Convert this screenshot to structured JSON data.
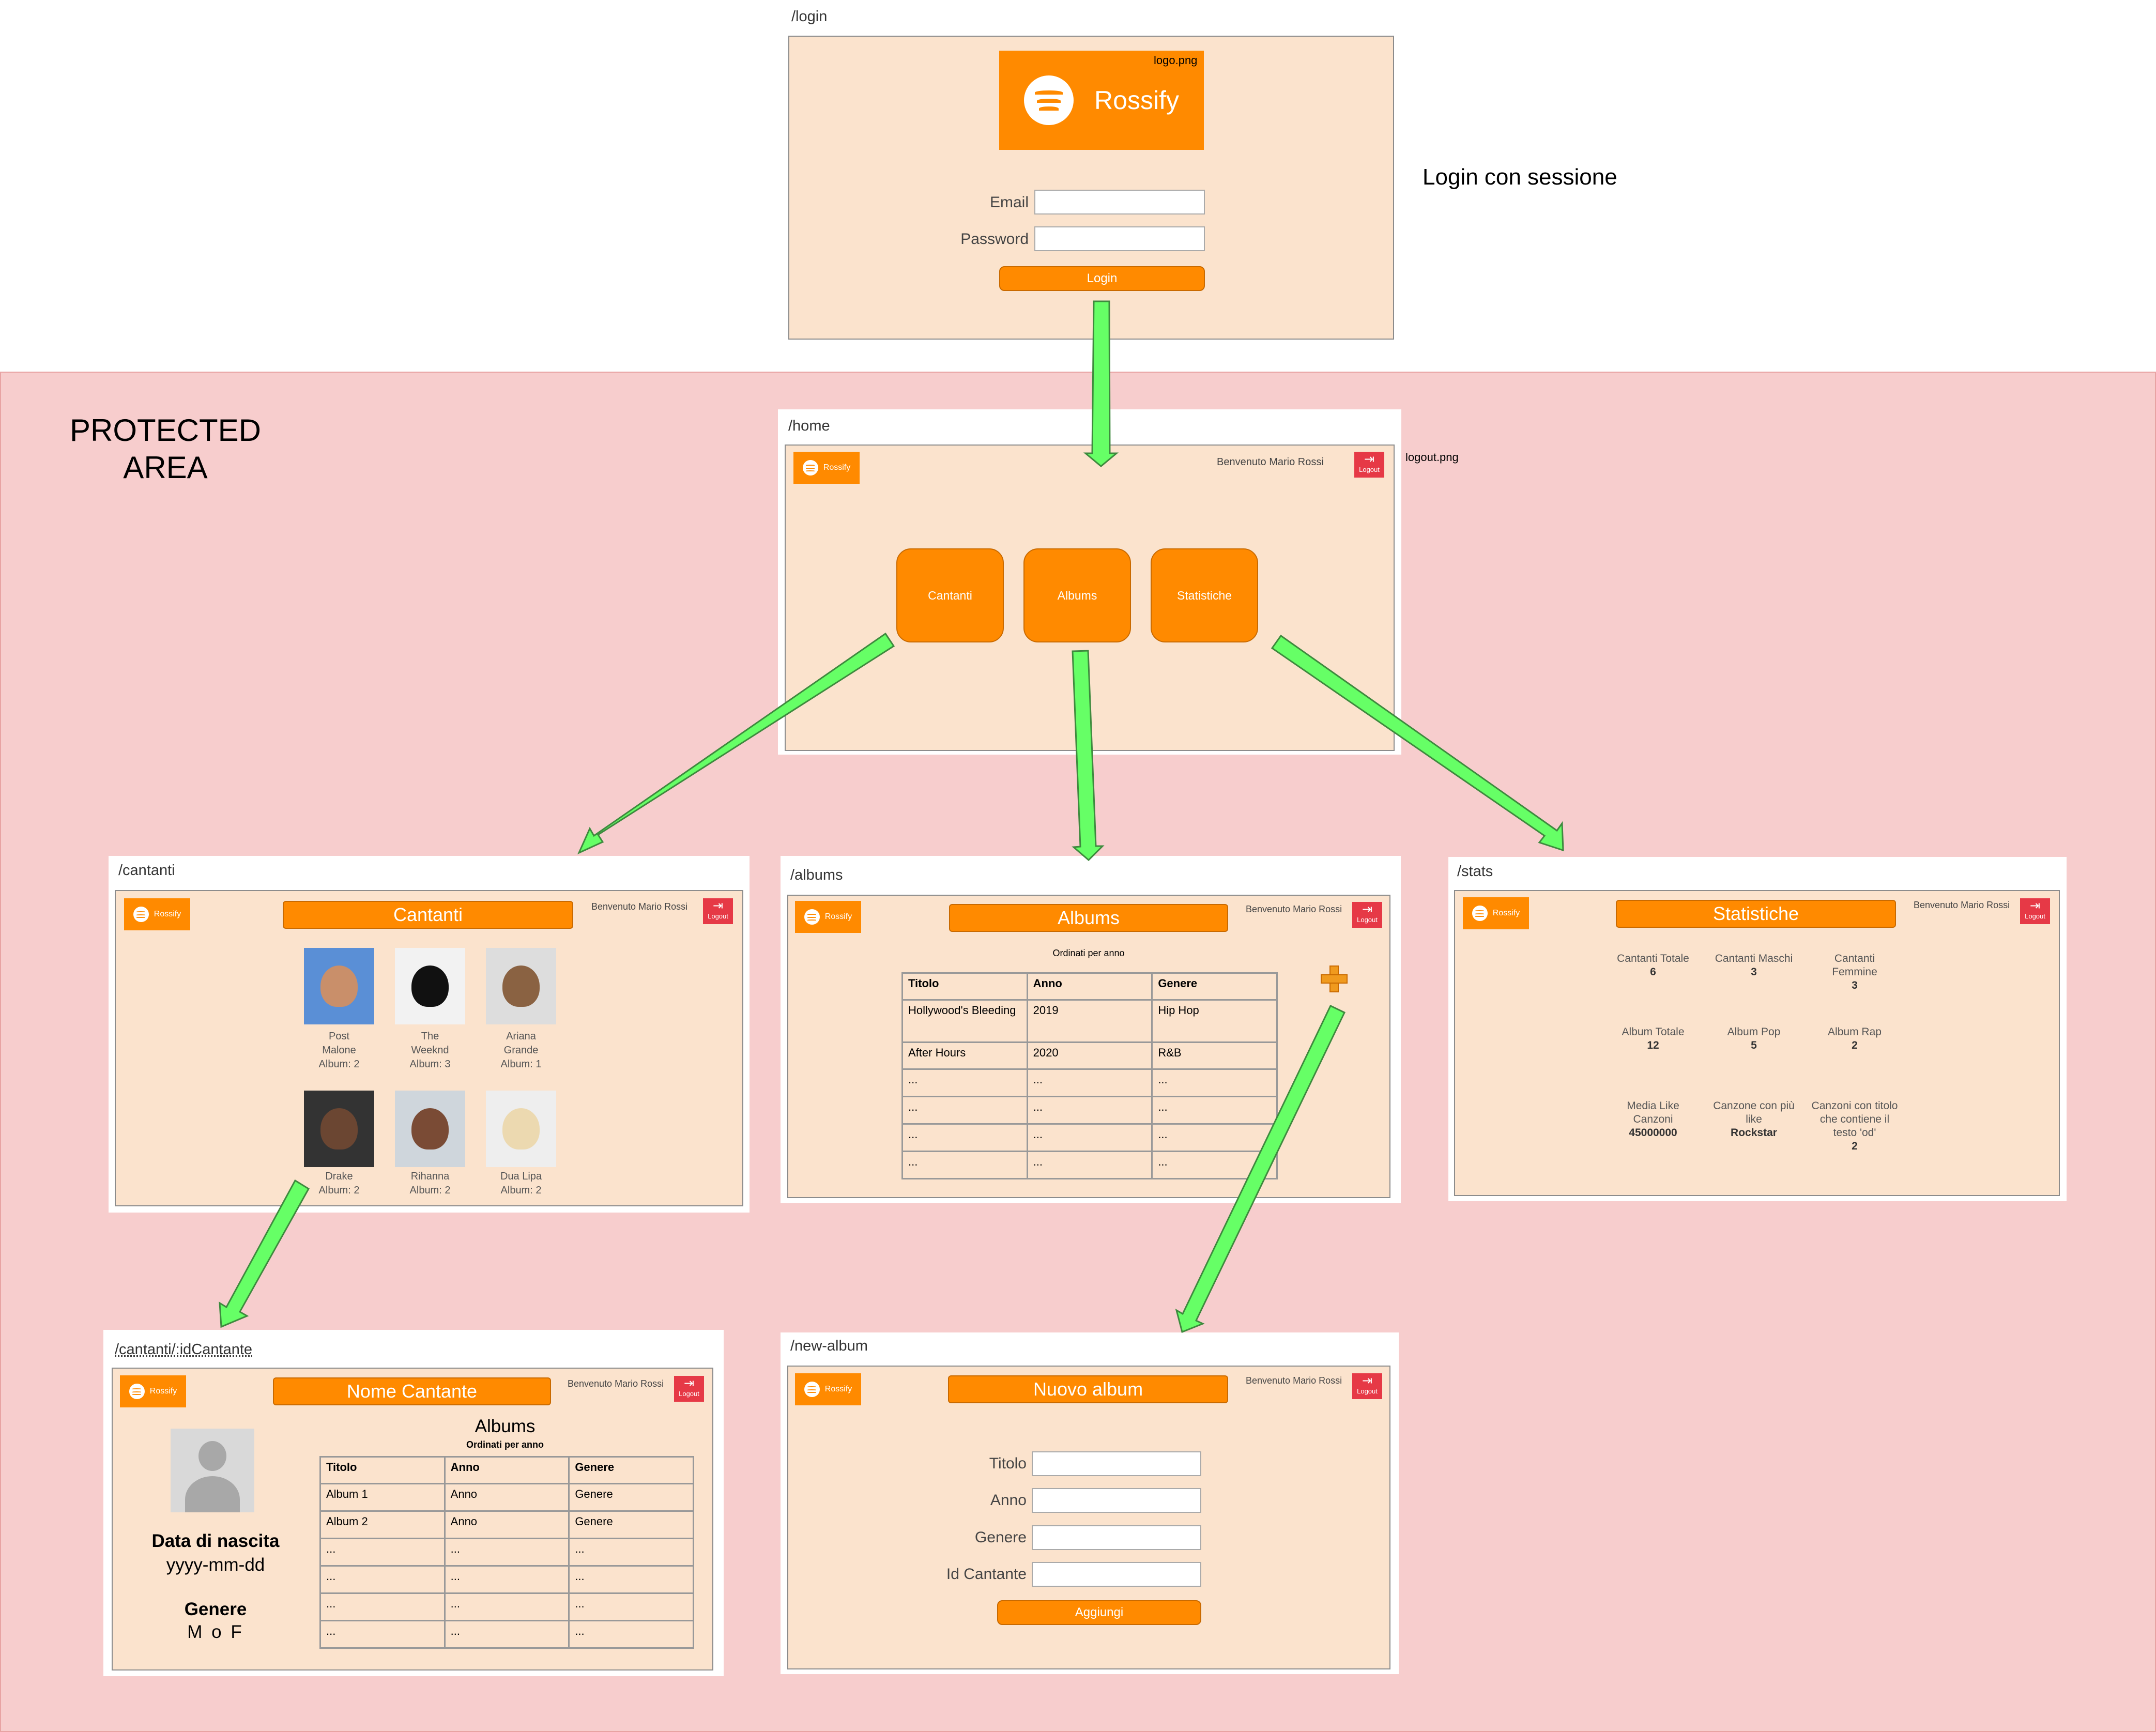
{
  "notes": {
    "protected_area": "PROTECTED AREA",
    "login_note": "Login con sessione",
    "logo_file": "logo.png",
    "logout_file": "logout.png"
  },
  "brand": {
    "name": "Rossify",
    "accent": "#ff8a00",
    "logout_color": "#e63946",
    "arrow_color": "#66ff66"
  },
  "header": {
    "welcome": "Benvenuto Mario Rossi",
    "logout": "Logout"
  },
  "login": {
    "route": "/login",
    "email_label": "Email",
    "password_label": "Password",
    "button": "Login"
  },
  "home": {
    "route": "/home",
    "buttons": [
      "Cantanti",
      "Albums",
      "Statistiche"
    ]
  },
  "cantanti": {
    "route": "/cantanti",
    "title": "Cantanti",
    "singers": [
      {
        "line1": "Post",
        "line2": "Malone",
        "albums": "Album: 2"
      },
      {
        "line1": "The",
        "line2": "Weeknd",
        "albums": "Album: 3"
      },
      {
        "line1": "Ariana",
        "line2": "Grande",
        "albums": "Album: 1"
      },
      {
        "line1": "",
        "line2": "Drake",
        "albums": "Album: 2"
      },
      {
        "line1": "",
        "line2": "Rihanna",
        "albums": "Album: 2"
      },
      {
        "line1": "",
        "line2": "Dua Lipa",
        "albums": "Album: 2"
      }
    ]
  },
  "albums": {
    "route": "/albums",
    "title": "Albums",
    "subtitle": "Ordinati per anno",
    "headers": [
      "Titolo",
      "Anno",
      "Genere"
    ],
    "rows": [
      [
        "Hollywood's Bleeding",
        "2019",
        "Hip Hop"
      ],
      [
        "After Hours",
        "2020",
        "R&B"
      ],
      [
        "...",
        "...",
        "..."
      ],
      [
        "...",
        "...",
        "..."
      ],
      [
        "...",
        "...",
        "..."
      ],
      [
        "...",
        "...",
        "..."
      ]
    ]
  },
  "stats": {
    "route": "/stats",
    "title": "Statistiche",
    "items": [
      {
        "label": "Cantanti Totale",
        "value": "6"
      },
      {
        "label": "Cantanti Maschi",
        "value": "3"
      },
      {
        "label": "Cantanti Femmine",
        "value": "3"
      },
      {
        "label": "Album Totale",
        "value": "12"
      },
      {
        "label": "Album Pop",
        "value": "5"
      },
      {
        "label": "Album Rap",
        "value": "2"
      },
      {
        "label": "Media Like Canzoni",
        "value": "45000000"
      },
      {
        "label": "Canzone con più like",
        "value": "Rockstar"
      },
      {
        "label": "Canzoni con titolo che contiene il testo 'od'",
        "value": "2"
      }
    ]
  },
  "singer_detail": {
    "route": "/cantanti/:idCantante",
    "title": "Nome Cantante",
    "albums_heading": "Albums",
    "albums_subtitle": "Ordinati per anno",
    "birth_label": "Data di nascita",
    "birth_value": "yyyy-mm-dd",
    "gender_label": "Genere",
    "gender_value": "M o F",
    "headers": [
      "Titolo",
      "Anno",
      "Genere"
    ],
    "rows": [
      [
        "Album 1",
        "Anno",
        "Genere"
      ],
      [
        "Album 2",
        "Anno",
        "Genere"
      ],
      [
        "...",
        "...",
        "..."
      ],
      [
        "...",
        "...",
        "..."
      ],
      [
        "...",
        "...",
        "..."
      ],
      [
        "...",
        "...",
        "..."
      ]
    ]
  },
  "new_album": {
    "route": "/new-album",
    "title": "Nuovo album",
    "fields": [
      "Titolo",
      "Anno",
      "Genere",
      "Id Cantante"
    ],
    "button": "Aggiungi"
  }
}
